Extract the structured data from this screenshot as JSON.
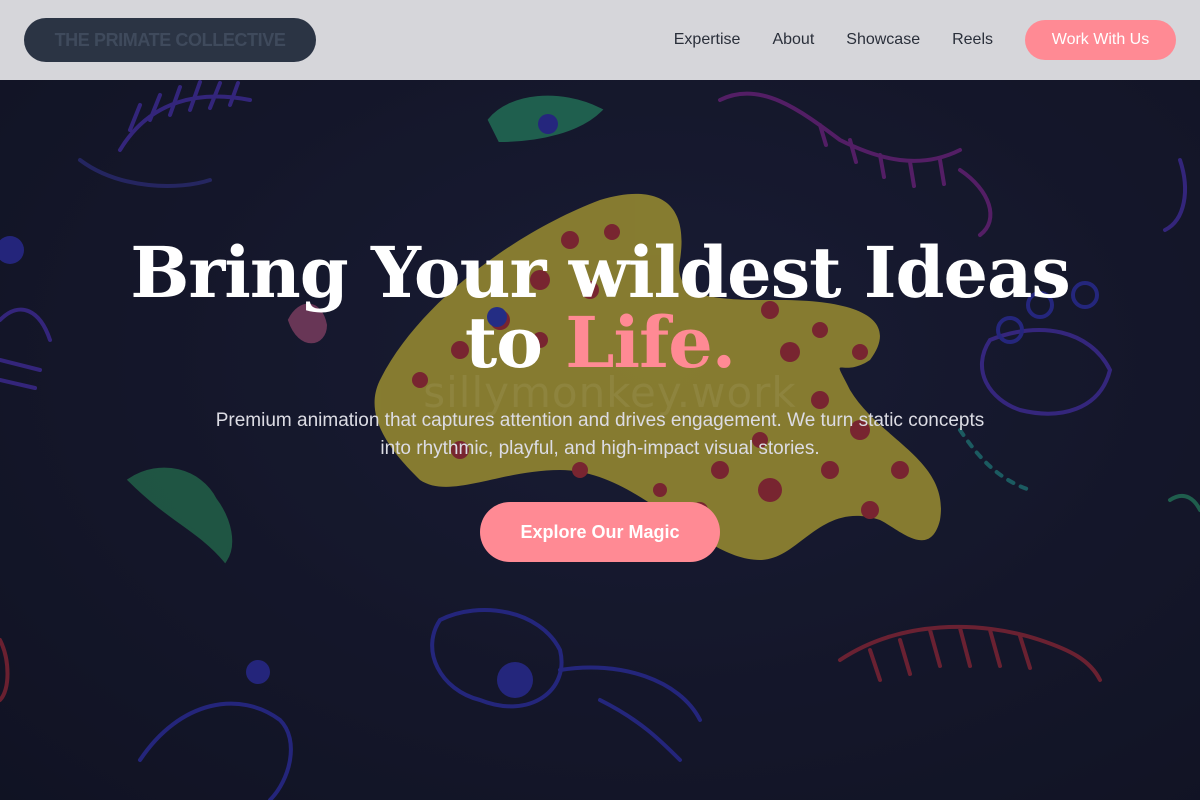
{
  "header": {
    "logo_text": "THE PRIMATE COLLECTIVE",
    "nav": [
      "Expertise",
      "About",
      "Showcase",
      "Reels"
    ],
    "cta_label": "Work With Us"
  },
  "hero": {
    "headline_line1": "Bring Your wildest Ideas",
    "headline_line2_prefix": "to ",
    "headline_accent": "Life.",
    "subtext": "Premium animation that captures attention and drives engagement. We turn static concepts into rhythmic, playful, and high-impact visual stories.",
    "cta_label": "Explore Our Magic",
    "watermark": "sillymonkey.work"
  },
  "colors": {
    "accent": "#ff8a94",
    "header_bg": "#d6d6da",
    "logo_bg": "#2b3444",
    "hero_bg": "#171a2e",
    "creature_yellow": "#e8d640",
    "creature_spots": "#d8343c"
  },
  "icons": {
    "background": "illustrated-creatures-background"
  }
}
